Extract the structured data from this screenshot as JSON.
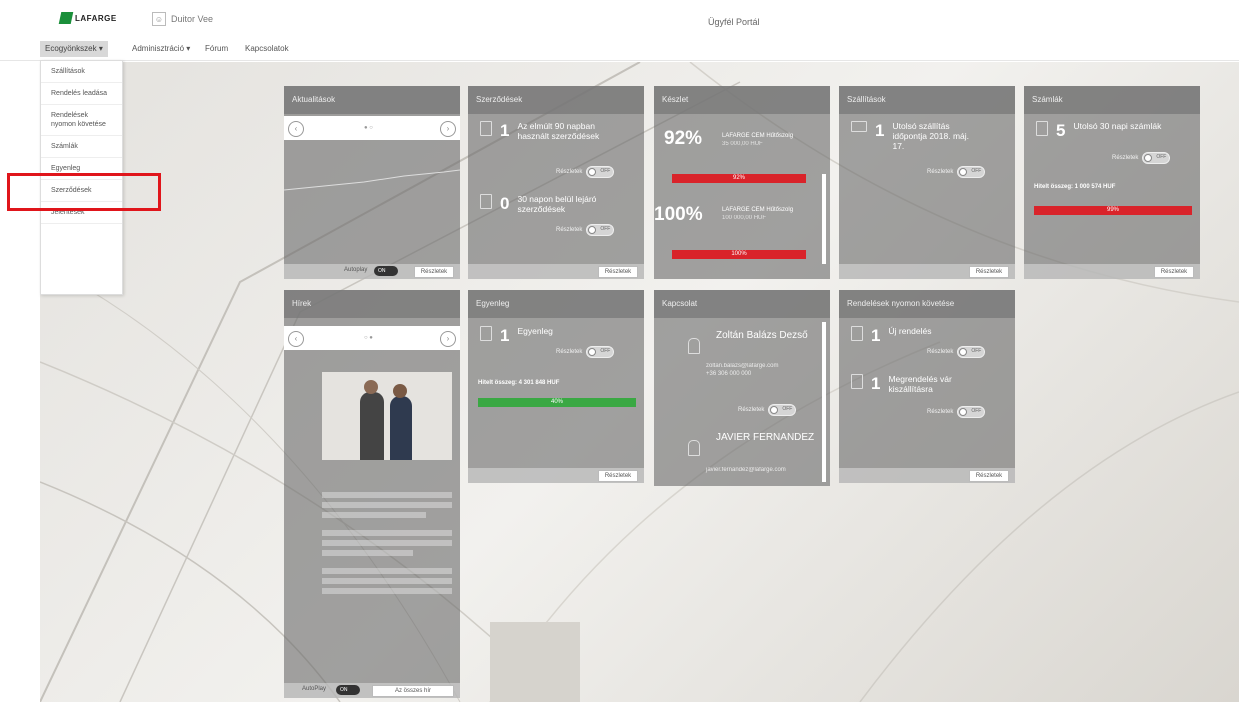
{
  "header": {
    "logo_text": "LAFARGE",
    "user_name": "Duitor Vee",
    "portal_title": "Ügyfél Portál"
  },
  "nav": {
    "items": [
      "Ecogyönkszek",
      "Adminisztráció",
      "Fórum",
      "Kapcsolatok"
    ]
  },
  "dropdown": {
    "items": [
      "Szállítások",
      "Rendelés leadása",
      "Rendelések nyomon követése",
      "Számlák",
      "Egyenleg",
      "Szerződések",
      "Jelentések"
    ]
  },
  "cards": {
    "aktualitasok": {
      "title": "Aktualitások",
      "toggle_label": "Autoplay",
      "toggle_state": "ON",
      "button": "Részletek"
    },
    "hirek": {
      "title": "Hírek",
      "toggle_label": "AutoPlay",
      "toggle_state": "ON",
      "button": "Az összes hír"
    },
    "szerzodesek": {
      "title": "Szerződések",
      "m1_num": "1",
      "m1_text": "Az elmúlt 90 napban használt szerződések",
      "m2_num": "0",
      "m2_text": "30 napon belül lejáró szerződések",
      "notify": "Részletek",
      "toggle": "OFF",
      "button": "Részletek"
    },
    "keszlet": {
      "title": "Készlet",
      "p1": "92%",
      "p1_name": "LAFARGE CEM Hűtőszolg",
      "p1_sub": "35 000,00 HUF",
      "p1_bar": "92%",
      "p2": "100%",
      "p2_name": "LAFARGE CEM Hűtőszolg",
      "p2_sub": "100 000,00 HUF",
      "p2_bar": "100%"
    },
    "szallitasok": {
      "title": "Szállítások",
      "num": "1",
      "text": "Utolsó szállítás időpontja 2018. máj. 17.",
      "notify": "Részletek",
      "toggle": "OFF",
      "button": "Részletek"
    },
    "szamlak": {
      "title": "Számlák",
      "num": "5",
      "text": "Utolsó 30 napi számlák",
      "notify": "Részletek",
      "toggle": "OFF",
      "credit": "Hitelt összeg: 1 000 574 HUF",
      "bar": "99%",
      "button": "Részletek"
    },
    "egyenleg": {
      "title": "Egyenleg",
      "num": "1",
      "text": "Egyenleg",
      "notify": "Részletek",
      "toggle": "OFF",
      "credit": "Hitelt összeg: 4 301 848 HUF",
      "bar": "40%",
      "button": "Részletek"
    },
    "kapcsolat": {
      "title": "Kapcsolat",
      "p1_name": "Zoltán Balázs Dezső",
      "p1_email": "zoltan.balazs@lafarge.com",
      "p1_phone": "+36 306 000 000",
      "notify": "Részletek",
      "toggle": "OFF",
      "p2_name": "JAVIER FERNANDEZ",
      "p2_email": "javier.fernandez@lafarge.com"
    },
    "rendelesek": {
      "title": "Rendelések nyomon követése",
      "m1_num": "1",
      "m1_text": "Új rendelés",
      "m2_num": "1",
      "m2_text": "Megrendelés vár kiszállításra",
      "notify": "Részletek",
      "toggle": "OFF",
      "button": "Részletek"
    }
  },
  "colors": {
    "accent_green": "#1a8f3a",
    "bar_red": "#d9232a",
    "bar_green": "#3aa843",
    "highlight_red": "#e0151b"
  }
}
